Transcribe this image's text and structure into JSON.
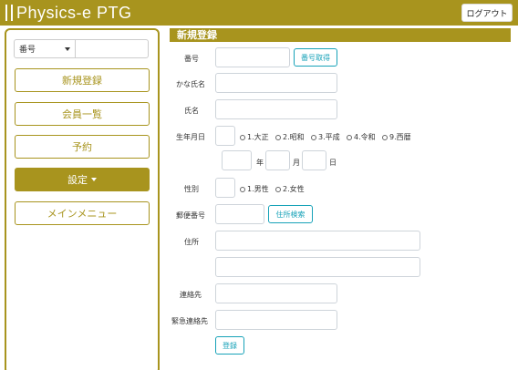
{
  "header": {
    "brand": "Physics-e PTG",
    "logout_label": "ログアウト"
  },
  "sidebar": {
    "search_select": "番号",
    "buttons": [
      "新規登録",
      "会員一覧",
      "予約",
      "設定",
      "メインメニュー"
    ]
  },
  "main": {
    "title": "新規登録",
    "labels": {
      "number": "番号",
      "kana_name": "かな氏名",
      "name": "氏名",
      "birthdate": "生年月日",
      "gender": "性別",
      "postal": "郵便番号",
      "address": "住所",
      "contact": "連絡先",
      "emergency": "緊急連絡先"
    },
    "buttons": {
      "get_number": "番号取得",
      "address_search": "住所検索",
      "register": "登録"
    },
    "era_options": [
      "1.大正",
      "2.昭和",
      "3.平成",
      "4.令和",
      "9.西暦"
    ],
    "date_units": [
      "年",
      "月",
      "日"
    ],
    "gender_options": [
      "1.男性",
      "2.女性"
    ]
  },
  "colors": {
    "brand": "#a8941e",
    "info": "#17a2b8"
  }
}
